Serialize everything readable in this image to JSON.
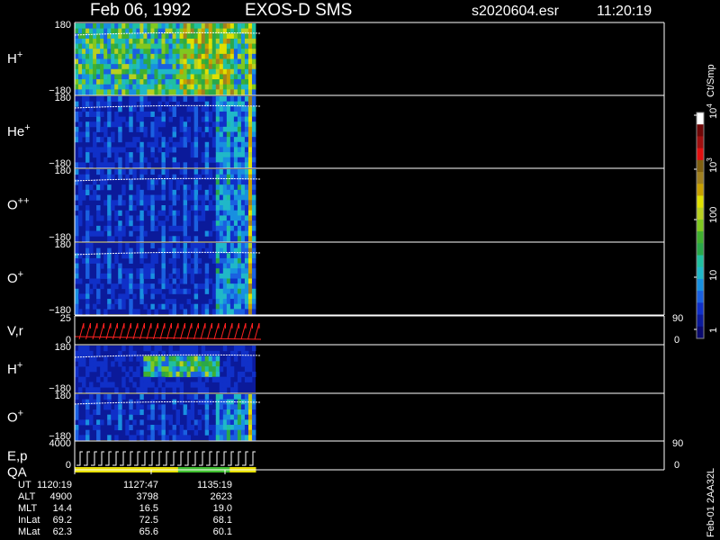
{
  "header": {
    "date": "Feb 06, 1992",
    "instrument": "EXOS-D SMS",
    "file": "s2020604.esr",
    "time": "11:20:19"
  },
  "colorbar": {
    "unit": "Ct/Smp",
    "tick_labels": [
      "1",
      "10",
      "100",
      "10",
      "10"
    ],
    "tick_exponents": [
      "",
      "",
      "",
      "3",
      "4"
    ],
    "tick_values": [
      1,
      10,
      100,
      1000,
      10000
    ],
    "colors": [
      "#0a0a6e",
      "#0b1a9a",
      "#1030c8",
      "#1a60e0",
      "#1890e0",
      "#20b8c8",
      "#20c0a0",
      "#2aa84a",
      "#40b030",
      "#80c820",
      "#b8d020",
      "#e0e000",
      "#c8a000",
      "#a08020",
      "#806010",
      "#e01010",
      "#a01010",
      "#700808",
      "#ffffff"
    ]
  },
  "side_note": "Feb-01 2AA32L",
  "panels": [
    {
      "id": "hplus1",
      "label": "H",
      "sup": "+",
      "ymax": "180",
      "ymin": "−180"
    },
    {
      "id": "heplus",
      "label": "He",
      "sup": "+",
      "ymax": "180",
      "ymin": "−180"
    },
    {
      "id": "oplusplus",
      "label": "O",
      "sup": "++",
      "ymax": "180",
      "ymin": "−180"
    },
    {
      "id": "oplus1",
      "label": "O",
      "sup": "+",
      "ymax": "180",
      "ymin": "−180"
    },
    {
      "id": "vr",
      "label": "V,r",
      "sup": "",
      "ymax": "25",
      "ymin": "0",
      "right_top": "90",
      "right_bottom": "0"
    },
    {
      "id": "hplus2",
      "label": "H",
      "sup": "+",
      "ymax": "180",
      "ymin": "−180"
    },
    {
      "id": "oplus2",
      "label": "O",
      "sup": "+",
      "ymax": "180",
      "ymin": "−180"
    },
    {
      "id": "ep",
      "label": "E,p",
      "sup": "",
      "label2": "QA",
      "ymax": "4000",
      "ymin": "0",
      "right_top": "90",
      "right_bottom": "0"
    }
  ],
  "chart_data": {
    "type": "heatmap",
    "title": "Feb 06, 1992   EXOS-D SMS",
    "xlabel": "UT",
    "colorbar_label": "Ct/Smp",
    "colorbar_scale": "log",
    "colorbar_range": [
      1,
      10000
    ],
    "ephemeris": {
      "row_labels": [
        "UT",
        "ALT",
        "MLT",
        "InLat",
        "MLat"
      ],
      "columns": [
        [
          "1120:19",
          "4900",
          "14.4",
          "69.2",
          "62.3"
        ],
        [
          "1127:47",
          "3798",
          "16.5",
          "72.5",
          "65.6"
        ],
        [
          "1135:19",
          "2623",
          "19.0",
          "68.1",
          "60.1"
        ]
      ]
    },
    "ut_ticks": [
      "1120:19",
      "1127:47",
      "1135:19"
    ],
    "qa_segments": [
      "yellow",
      "yellow",
      "yellow",
      "yellow",
      "green",
      "green",
      "yellow"
    ]
  }
}
